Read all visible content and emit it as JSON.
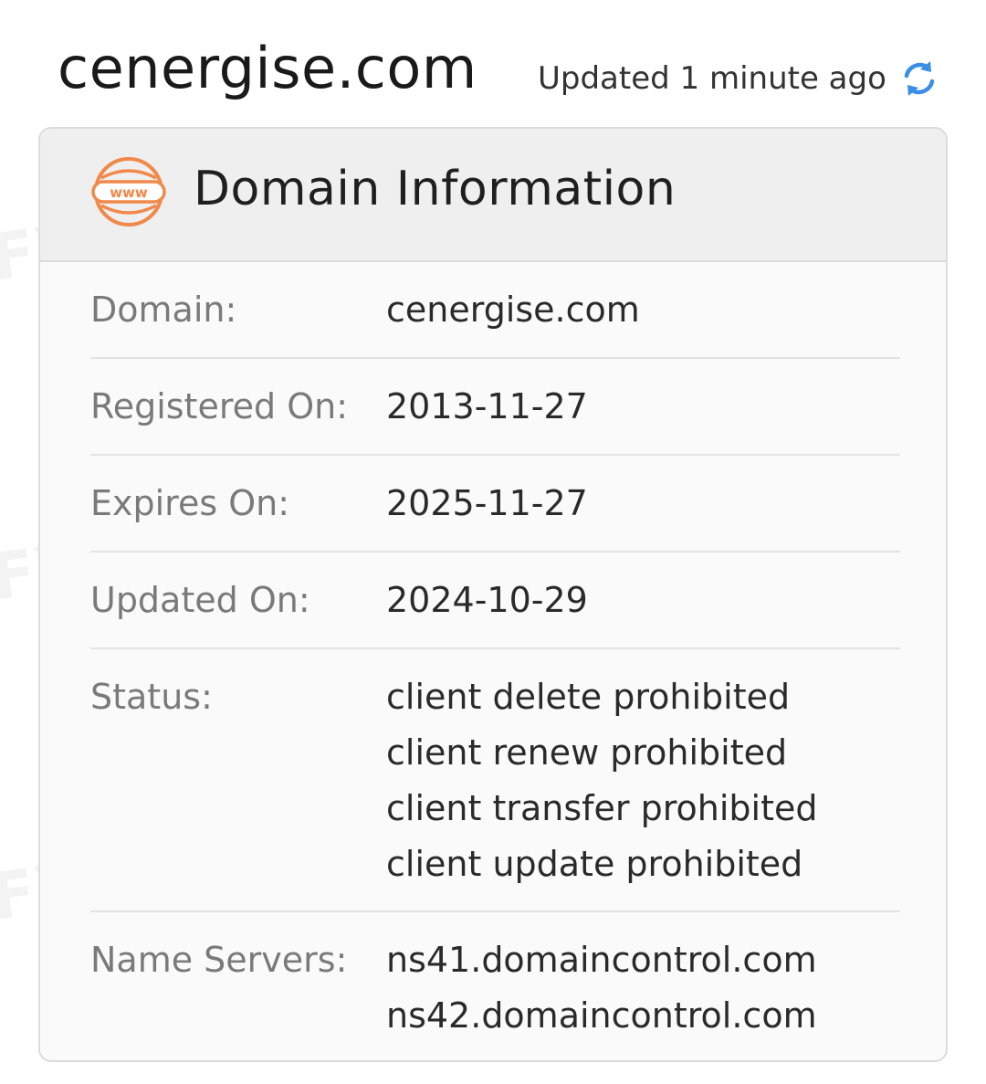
{
  "header": {
    "site_title": "cenergise.com",
    "updated_text": "Updated 1 minute ago",
    "refresh_icon": "refresh-icon"
  },
  "card": {
    "title": "Domain Information",
    "icon": "www-globe-icon",
    "icon_label": "www",
    "accent_color": "#f0894a",
    "rows": [
      {
        "label": "Domain:",
        "values": [
          "cenergise.com"
        ]
      },
      {
        "label": "Registered On:",
        "values": [
          "2013-11-27"
        ]
      },
      {
        "label": "Expires On:",
        "values": [
          "2025-11-27"
        ]
      },
      {
        "label": "Updated On:",
        "values": [
          "2024-10-29"
        ]
      },
      {
        "label": "Status:",
        "values": [
          "client delete prohibited",
          "client renew prohibited",
          "client transfer prohibited",
          "client update prohibited"
        ]
      },
      {
        "label": "Name Servers:",
        "values": [
          "ns41.domaincontrol.com",
          "ns42.domaincontrol.com"
        ]
      }
    ]
  },
  "watermark": {
    "text": "WikiFX",
    "fragment": "FX"
  }
}
